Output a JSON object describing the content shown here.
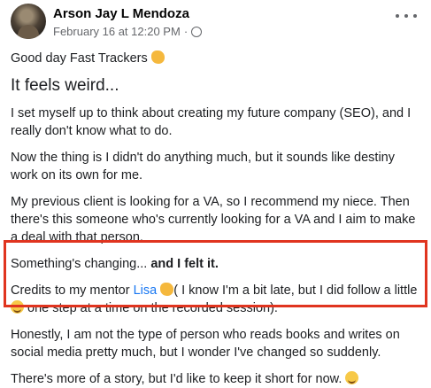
{
  "post": {
    "author": "Arson Jay L Mendoza",
    "timestamp": "February 16 at 12:20 PM",
    "separator": "·",
    "audience_icon": "globe-icon",
    "more_icon": "more-horizontal-icon",
    "greeting": "Good day Fast Trackers",
    "heading": "It feels weird...",
    "para1": "I set myself up to think about creating my future company (SEO), and I really don't know what to do.",
    "para2": "Now the thing is I didn't do anything much, but it sounds like destiny work on its own for me.",
    "para3": "My previous client is looking for a VA, so I recommend my niece. Then there's this someone who's currently looking for a VA and I aim to make a deal with that person.",
    "para4_part1": "Something's changing... ",
    "para4_bold": "and I felt it.",
    "para5_prefix": "Credits to my mentor ",
    "para5_link": "Lisa",
    "para5_mid": "( I know I'm a bit late, but I did follow a little ",
    "para5_suffix": " one step at a time on the recorded session).",
    "para6": "Honestly, I am not the type of person who reads books and writes on social media pretty much, but I wonder I've changed so suddenly.",
    "para7": "There's more of a story, but I'd like to keep it short for now."
  },
  "colors": {
    "highlight_border": "#e0341f",
    "link": "#1877f2",
    "meta_text": "#65676b"
  }
}
